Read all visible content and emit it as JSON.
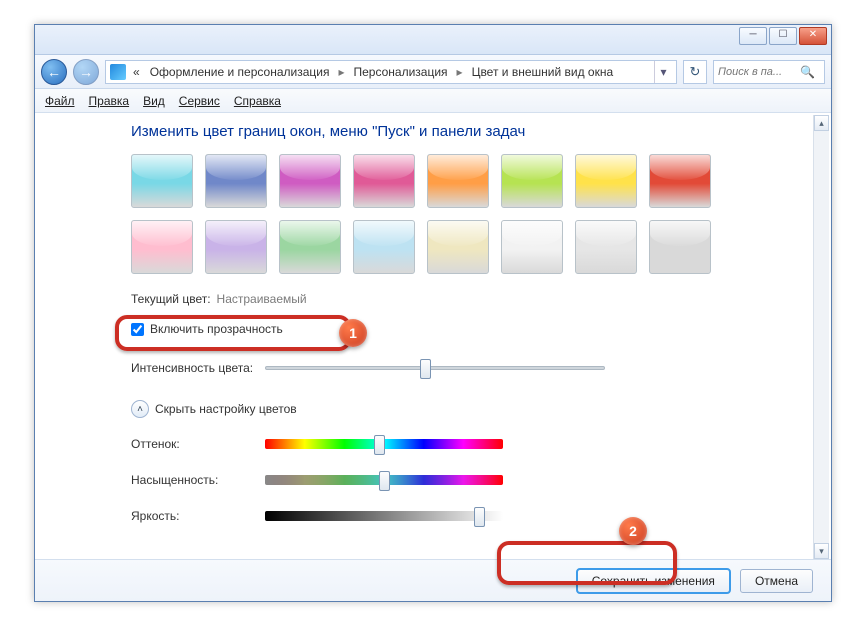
{
  "titlebar": {
    "min": "─",
    "max": "☐",
    "close": "✕"
  },
  "breadcrumb": {
    "back_prefix": "«",
    "b1": "Оформление и персонализация",
    "b2": "Персонализация",
    "b3": "Цвет и внешний вид окна"
  },
  "search": {
    "placeholder": "Поиск в па...",
    "icon": "🔍"
  },
  "refresh_icon": "↻",
  "menubar": {
    "file": "Файл",
    "edit": "Правка",
    "view": "Вид",
    "tools": "Сервис",
    "help": "Справка"
  },
  "page": {
    "heading": "Изменить цвет границ окон, меню \"Пуск\" и панели задач",
    "current_label": "Текущий цвет:",
    "current_value": "Настраиваемый",
    "transparency_label": "Включить прозрачность",
    "intensity_label": "Интенсивность цвета:",
    "collapse_label": "Скрыть настройку цветов",
    "hue_label": "Оттенок:",
    "sat_label": "Насыщенность:",
    "bri_label": "Яркость:"
  },
  "swatches": [
    "#79d8e6",
    "#7088c9",
    "#cf5cc2",
    "#e05a97",
    "#ff9e46",
    "#b6e352",
    "#ffe24a",
    "#e24a37",
    "#ffbdcf",
    "#c9b3e8",
    "#9bd6a1",
    "#bde2f2",
    "#efe7c0",
    "#f2f2f2",
    "#e6e6e6",
    "#d9d9d9"
  ],
  "sliders": {
    "intensity": 0.47,
    "hue": 0.48,
    "saturation": 0.5,
    "brightness": 0.92
  },
  "footer": {
    "save": "Сохранить изменения",
    "cancel": "Отмена"
  },
  "callouts": {
    "c1": "1",
    "c2": "2"
  }
}
